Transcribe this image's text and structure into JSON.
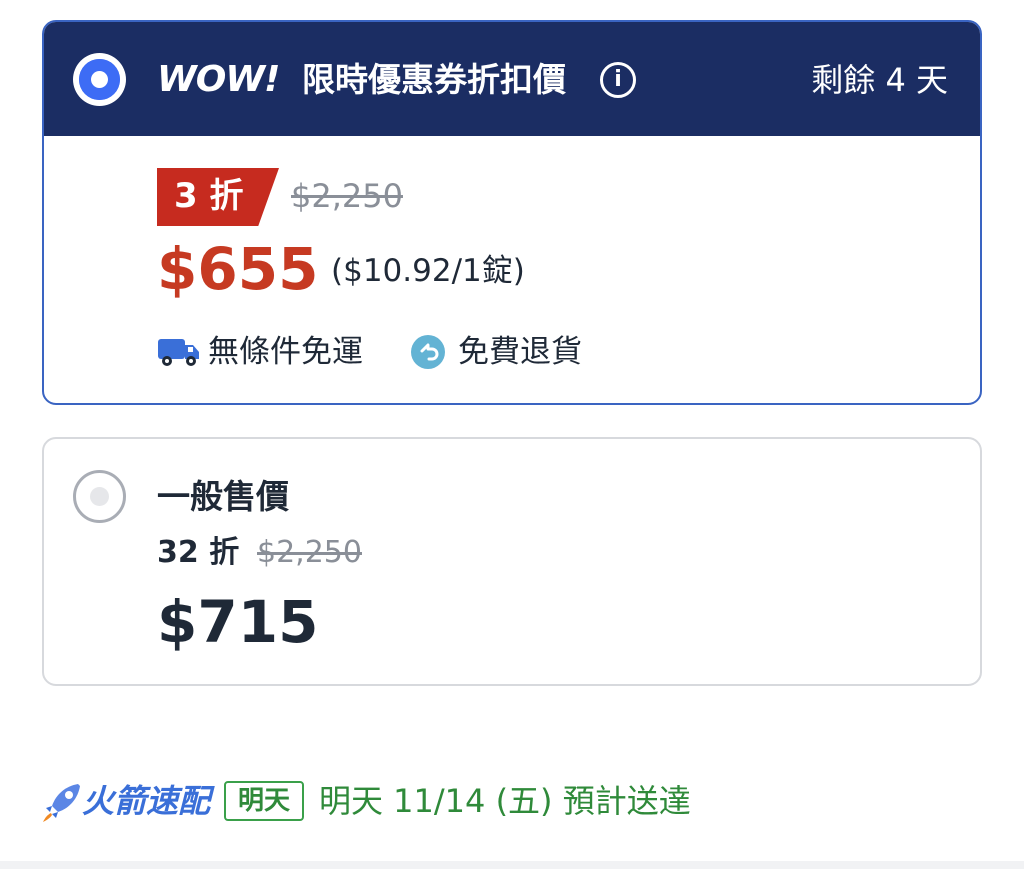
{
  "wow_option": {
    "logo_text": "WOW!",
    "title": "限時優惠券折扣價",
    "info_icon_glyph": "i",
    "days_left": "剩餘 4 天",
    "discount_badge": "3 折",
    "original_price": "$2,250",
    "price": "$655",
    "unit_price": "($10.92/1錠)",
    "shipping_label": "無條件免運",
    "return_label": "免費退貨",
    "selected": true,
    "colors": {
      "header_bg": "#1b2d63",
      "price": "#c63a22",
      "badge": "#c62b1f",
      "radio": "#3d6cf5"
    }
  },
  "regular_option": {
    "title": "一般售價",
    "discount": "32 折",
    "original_price": "$2,250",
    "price": "$715",
    "selected": false
  },
  "delivery": {
    "icon": "rocket-icon",
    "service_label": "火箭速配",
    "badge": "明天",
    "eta": "明天 11/14 (五) 預計送達",
    "colors": {
      "service": "#3a6fd8",
      "eta": "#2f8a3a"
    }
  }
}
